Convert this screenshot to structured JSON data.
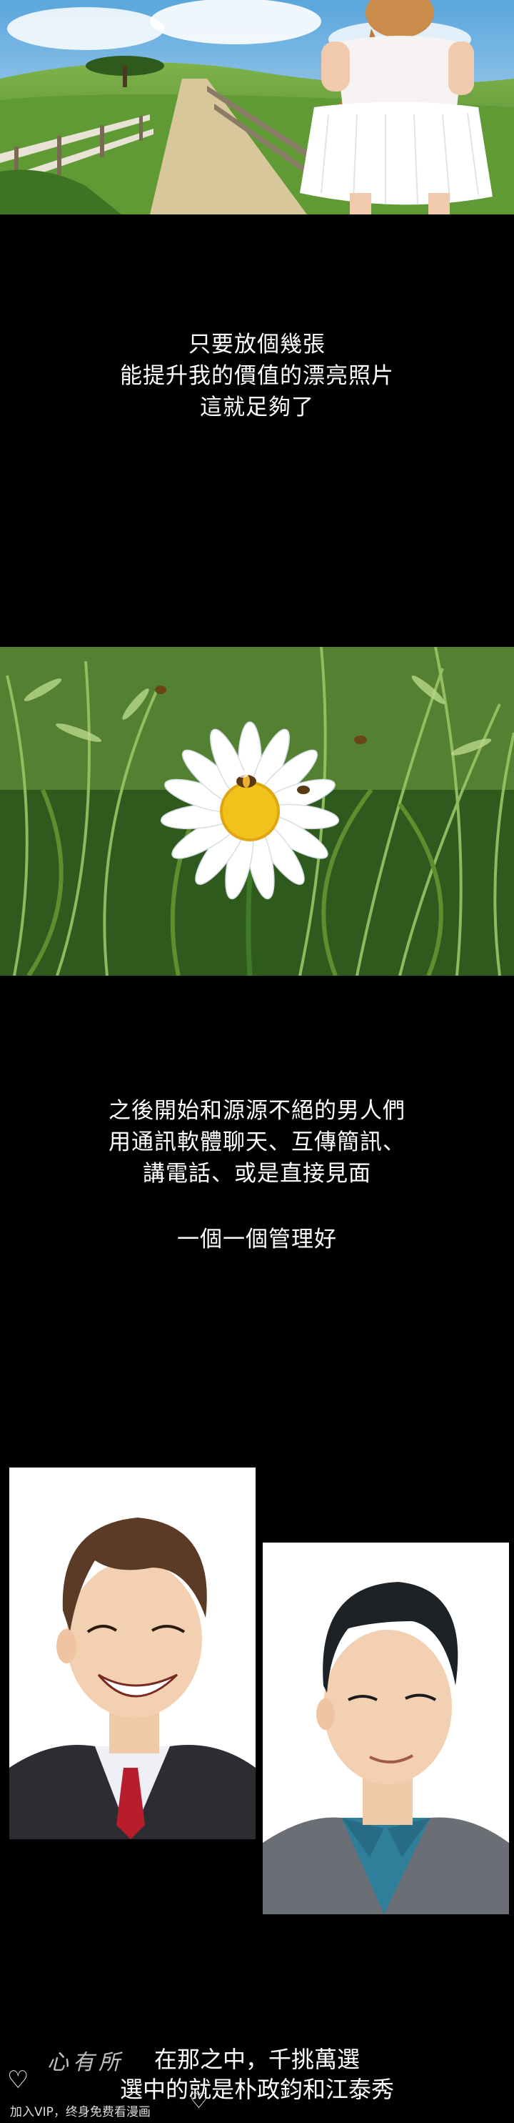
{
  "captions": {
    "block1": [
      "只要放個幾張",
      "能提升我的價值的漂亮照片",
      "這就足夠了"
    ],
    "block2": [
      "之後開始和源源不絕的男人們",
      "用通訊軟體聊天、互傳簡訊、",
      "講電話、或是直接見面"
    ],
    "block3": [
      "一個一個管理好"
    ],
    "block4": [
      "在那之中，千挑萬選",
      "選中的就是朴政鈞和江泰秀"
    ]
  },
  "watermark": {
    "script_text": "心有所",
    "note": "加入VIP，终身免费看漫画"
  },
  "colors": {
    "background": "#000000",
    "caption_text": "#ffffff",
    "sky": "#8fc3ea",
    "grass": "#4f8a2e",
    "daisy_center": "#f2c21c",
    "tie_red": "#b81d2b",
    "shirt_teal": "#2f7f9a"
  }
}
